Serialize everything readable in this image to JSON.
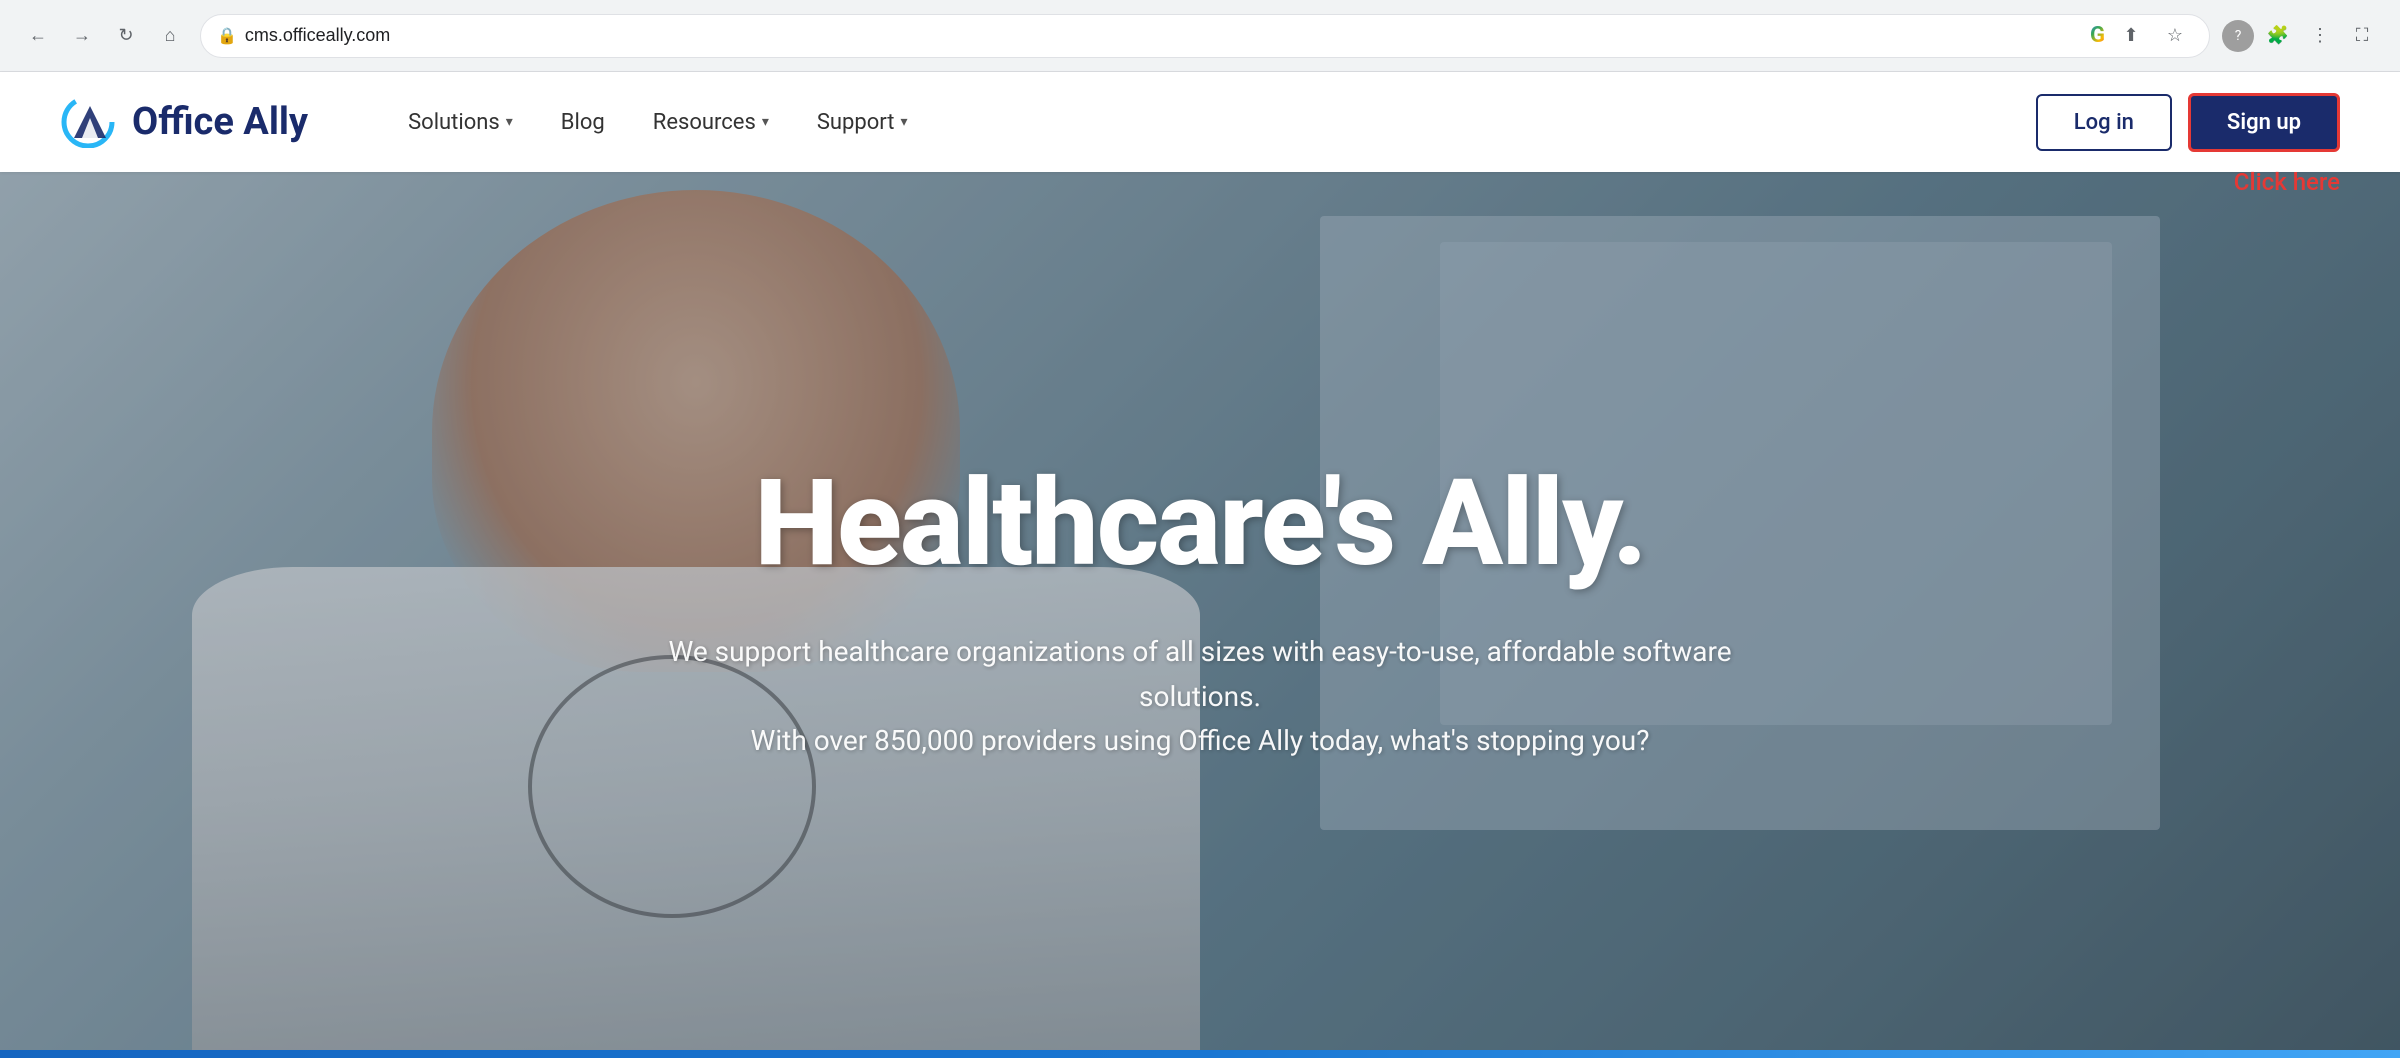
{
  "browser": {
    "url": "cms.officeally.com",
    "back_label": "←",
    "forward_label": "→",
    "reload_label": "↻",
    "home_label": "⌂"
  },
  "navbar": {
    "logo_text": "Office Ally",
    "nav_items": [
      {
        "label": "Solutions",
        "has_dropdown": true
      },
      {
        "label": "Blog",
        "has_dropdown": false
      },
      {
        "label": "Resources",
        "has_dropdown": true
      },
      {
        "label": "Support",
        "has_dropdown": true
      }
    ],
    "login_label": "Log in",
    "signup_label": "Sign up",
    "click_here_label": "Click here"
  },
  "hero": {
    "title": "Healthcare's Ally.",
    "subtitle": "We support healthcare organizations of all sizes with easy-to-use, affordable software solutions.\nWith over 850,000 providers using Office Ally today, what's stopping you?"
  }
}
